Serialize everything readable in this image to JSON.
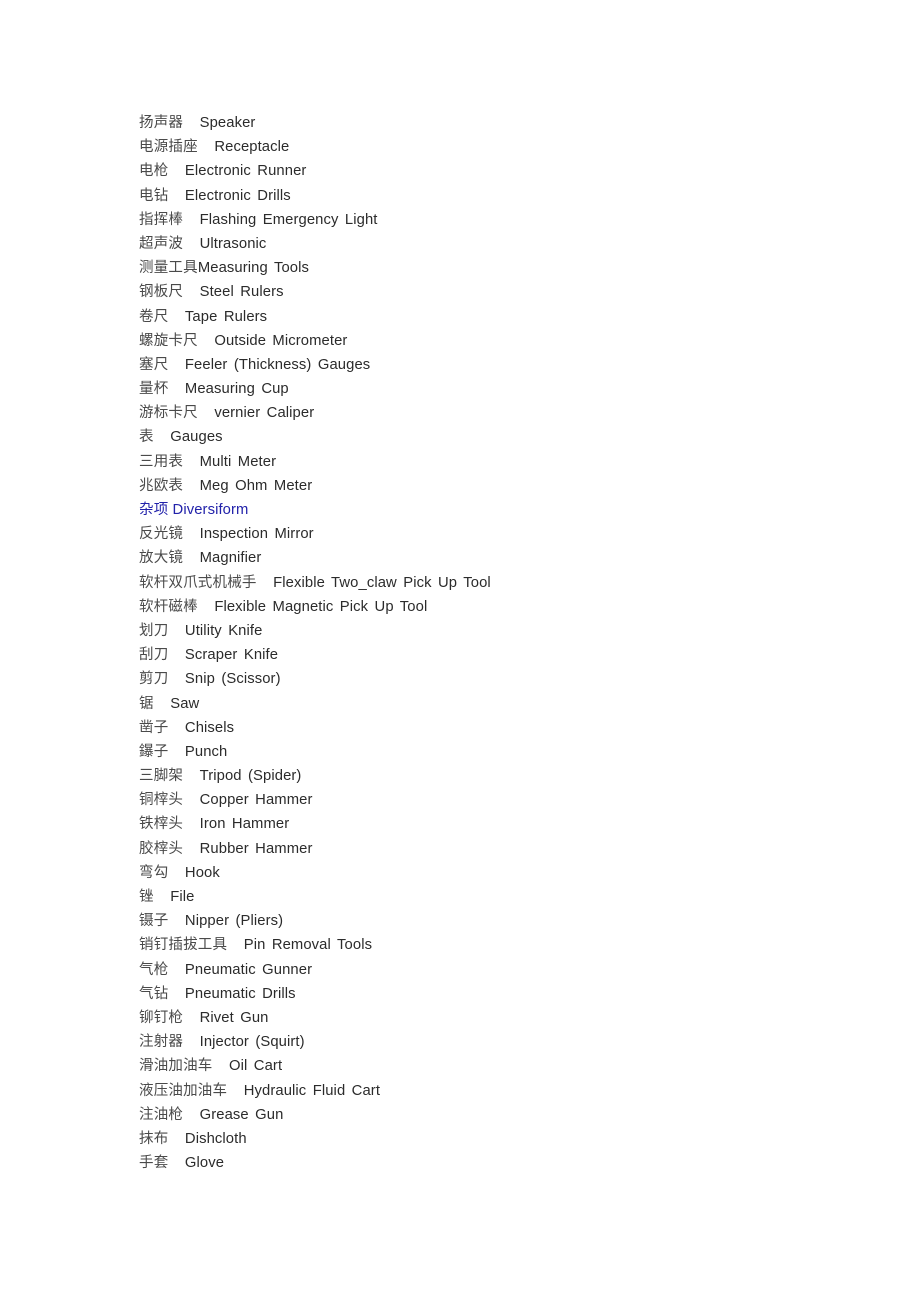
{
  "document": {
    "title": "Bilingual Tool Glossary",
    "background_color": "#ffffff",
    "text_color": "#2b2b2b",
    "heading_color": "#2222aa"
  },
  "entries": [
    {
      "cn": "扬声器",
      "gap": "    ",
      "en": "Speaker",
      "heading": false
    },
    {
      "cn": "电源插座",
      "gap": "    ",
      "en": "Receptacle",
      "heading": false
    },
    {
      "cn": "电枪",
      "gap": "    ",
      "en": "Electronic Runner",
      "heading": false
    },
    {
      "cn": "电钻",
      "gap": "    ",
      "en": "Electronic Drills",
      "heading": false
    },
    {
      "cn": "指挥棒",
      "gap": "    ",
      "en": "Flashing Emergency Light",
      "heading": false
    },
    {
      "cn": "超声波",
      "gap": "    ",
      "en": "Ultrasonic",
      "heading": false
    },
    {
      "cn": "测量工具",
      "gap": "",
      "en": "Measuring Tools",
      "heading": false
    },
    {
      "cn": "钢板尺",
      "gap": "    ",
      "en": "Steel Rulers",
      "heading": false
    },
    {
      "cn": "卷尺",
      "gap": "    ",
      "en": "Tape Rulers",
      "heading": false
    },
    {
      "cn": "螺旋卡尺",
      "gap": "    ",
      "en": "Outside Micrometer",
      "heading": false
    },
    {
      "cn": "塞尺",
      "gap": "    ",
      "en": "Feeler (Thickness) Gauges",
      "heading": false
    },
    {
      "cn": "量杯",
      "gap": "    ",
      "en": "Measuring Cup",
      "heading": false
    },
    {
      "cn": "游标卡尺",
      "gap": "    ",
      "en": "vernier Caliper",
      "heading": false
    },
    {
      "cn": "表",
      "gap": "    ",
      "en": "Gauges",
      "heading": false
    },
    {
      "cn": "三用表",
      "gap": "    ",
      "en": "Multi Meter",
      "heading": false
    },
    {
      "cn": "兆欧表",
      "gap": "    ",
      "en": "Meg Ohm Meter",
      "heading": false
    },
    {
      "cn": "杂项",
      "gap": " ",
      "en": "Diversiform",
      "heading": true
    },
    {
      "cn": "反光镜",
      "gap": "    ",
      "en": "Inspection Mirror",
      "heading": false
    },
    {
      "cn": "放大镜",
      "gap": "    ",
      "en": "Magnifier",
      "heading": false
    },
    {
      "cn": "软杆双爪式机械手",
      "gap": "    ",
      "en": "Flexible Two_claw Pick Up Tool",
      "heading": false
    },
    {
      "cn": "软杆磁棒",
      "gap": "    ",
      "en": "Flexible Magnetic Pick Up Tool",
      "heading": false
    },
    {
      "cn": "划刀",
      "gap": "    ",
      "en": "Utility Knife",
      "heading": false
    },
    {
      "cn": "刮刀",
      "gap": "    ",
      "en": "Scraper Knife",
      "heading": false
    },
    {
      "cn": "剪刀",
      "gap": "    ",
      "en": "Snip (Scissor)",
      "heading": false
    },
    {
      "cn": "锯",
      "gap": "    ",
      "en": "Saw",
      "heading": false
    },
    {
      "cn": "凿子",
      "gap": "    ",
      "en": "Chisels",
      "heading": false
    },
    {
      "cn": "鑤子",
      "gap": "    ",
      "en": "Punch",
      "heading": false
    },
    {
      "cn": "三脚架",
      "gap": "    ",
      "en": "Tripod (Spider)",
      "heading": false
    },
    {
      "cn": "铜榟头",
      "gap": "    ",
      "en": "Copper Hammer",
      "heading": false
    },
    {
      "cn": "铁榟头",
      "gap": "    ",
      "en": "Iron Hammer",
      "heading": false
    },
    {
      "cn": "胶榟头",
      "gap": "    ",
      "en": "Rubber Hammer",
      "heading": false
    },
    {
      "cn": "弯勾",
      "gap": "    ",
      "en": "Hook",
      "heading": false
    },
    {
      "cn": "锉",
      "gap": "    ",
      "en": "File",
      "heading": false
    },
    {
      "cn": "镊子",
      "gap": "    ",
      "en": "Nipper (Pliers)",
      "heading": false
    },
    {
      "cn": "销钉插拔工具",
      "gap": "    ",
      "en": "Pin Removal Tools",
      "heading": false
    },
    {
      "cn": "气枪",
      "gap": "    ",
      "en": "Pneumatic Gunner",
      "heading": false
    },
    {
      "cn": "气钻",
      "gap": "    ",
      "en": "Pneumatic Drills",
      "heading": false
    },
    {
      "cn": "铆钉枪",
      "gap": "    ",
      "en": "Rivet Gun",
      "heading": false
    },
    {
      "cn": "注射器",
      "gap": "    ",
      "en": "Injector (Squirt)",
      "heading": false
    },
    {
      "cn": "滑油加油车",
      "gap": "    ",
      "en": "Oil Cart",
      "heading": false
    },
    {
      "cn": "液压油加油车",
      "gap": "    ",
      "en": "Hydraulic Fluid Cart",
      "heading": false
    },
    {
      "cn": "注油枪",
      "gap": "    ",
      "en": "Grease Gun",
      "heading": false
    },
    {
      "cn": "抹布",
      "gap": "    ",
      "en": "Dishcloth",
      "heading": false
    },
    {
      "cn": "手套",
      "gap": "    ",
      "en": "Glove",
      "heading": false
    }
  ]
}
